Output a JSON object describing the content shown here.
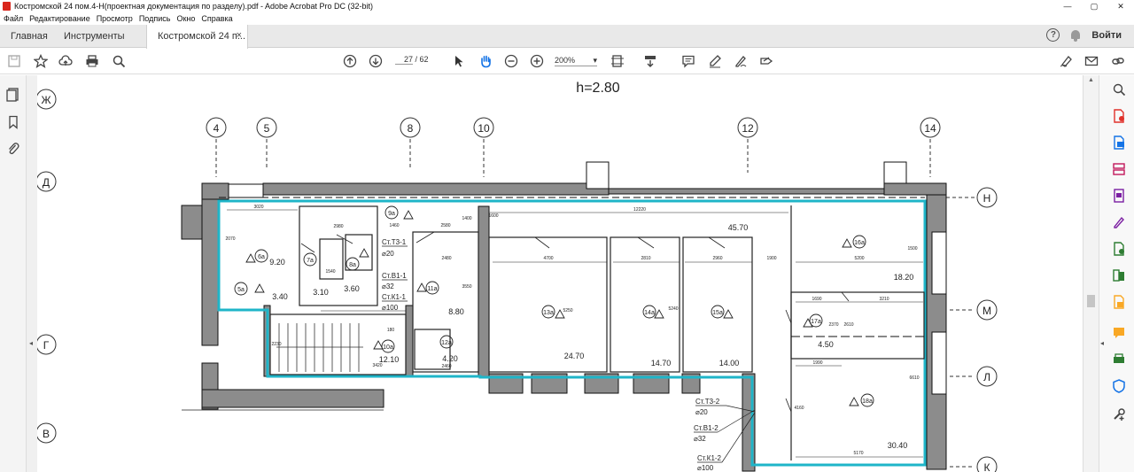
{
  "window": {
    "title": "Костромской 24 пом.4-Н(проектная документация по разделу).pdf - Adobe Acrobat Pro DC (32-bit)",
    "controls": [
      "—",
      "▢",
      "✕"
    ]
  },
  "menu": [
    "Файл",
    "Редактирование",
    "Просмотр",
    "Подпись",
    "Окно",
    "Справка"
  ],
  "tabs": {
    "home": "Главная",
    "tools": "Инструменты",
    "doc": "Костромской 24 п...",
    "close": "×",
    "login": "Войти",
    "help": "?"
  },
  "toolbar": {
    "page_current": "27",
    "page_sep": "/",
    "page_total": "62",
    "zoom": "200%"
  },
  "drawing": {
    "header": "h=2.80",
    "axes_top": [
      "4",
      "5",
      "8",
      "10",
      "12",
      "14"
    ],
    "axes_left": [
      "Ж",
      "Д",
      "Г",
      "В"
    ],
    "axes_right": [
      "Н",
      "М",
      "Л",
      "К"
    ],
    "room_areas": [
      "9.20",
      "3.40",
      "3.10",
      "3.60",
      "12.10",
      "8.80",
      "4.20",
      "24.70",
      "14.70",
      "14.00",
      "45.70",
      "18.20",
      "4.50",
      "30.40"
    ],
    "room_tags": [
      "6а",
      "5а",
      "7а",
      "8а",
      "9а",
      "10а",
      "11а",
      "12а",
      "13а",
      "14а",
      "15а",
      "16а",
      "17а",
      "18а"
    ],
    "dims": [
      "3020",
      "2980",
      "1460",
      "2580",
      "12220",
      "4700",
      "2810",
      "2960",
      "1900",
      "5200",
      "3210",
      "1690",
      "1990",
      "6610",
      "5170",
      "3420",
      "2480",
      "2460",
      "5250",
      "5240",
      "3550",
      "1540",
      "2370",
      "2610",
      "4160",
      "1400",
      "1600",
      "2070",
      "2230",
      "180",
      "1500"
    ],
    "risers": [
      {
        "name": "Ст.Т3-1",
        "dia": "⌀20"
      },
      {
        "name": "Ст.В1-1",
        "dia": "⌀32"
      },
      {
        "name": "Ст.К1-1",
        "dia": "⌀100"
      },
      {
        "name": "Ст.Т3-2",
        "dia": "⌀20"
      },
      {
        "name": "Ст.В1-2",
        "dia": "⌀32"
      },
      {
        "name": "Ст.К1-2",
        "dia": "⌀100"
      }
    ]
  },
  "colors": {
    "accent_cyan": "#1fb5c8",
    "wall_gray": "#8c8c8c",
    "line": "#1a1a1a"
  }
}
